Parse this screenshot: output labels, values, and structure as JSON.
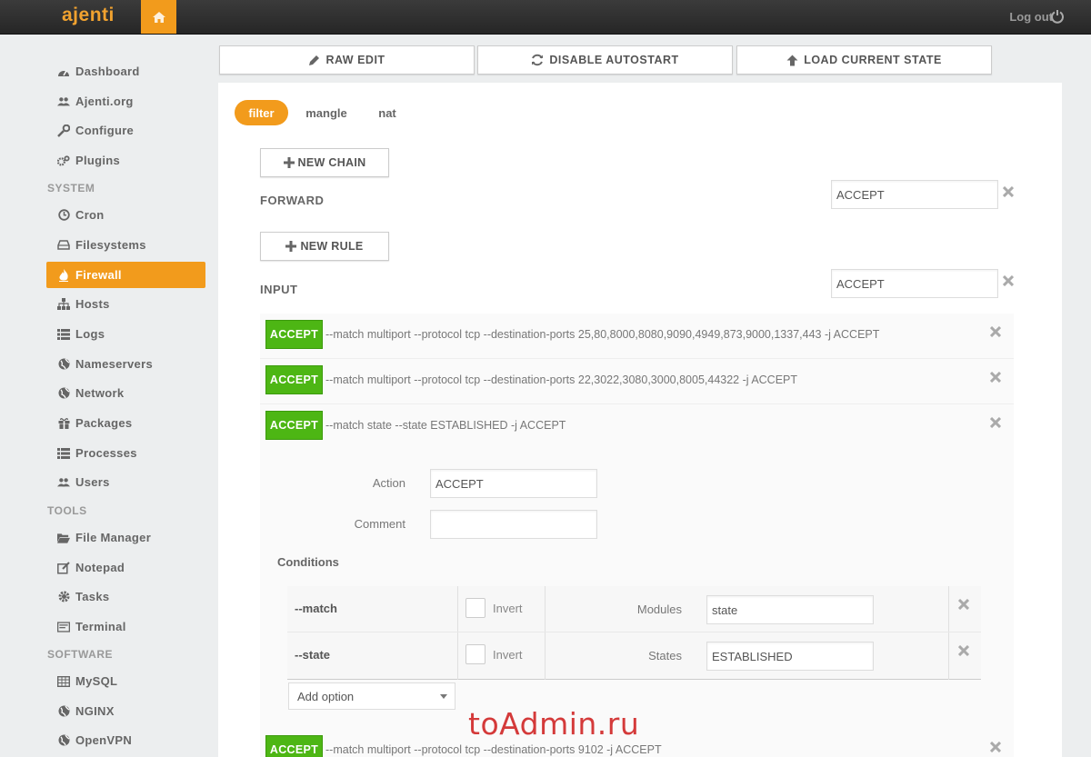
{
  "app": {
    "brand": "ajenti",
    "logout_label": "Log out"
  },
  "sidebar": {
    "items_top": [
      {
        "label": "Dashboard",
        "icon": "dashboard-icon"
      },
      {
        "label": "Ajenti.org",
        "icon": "users-icon"
      },
      {
        "label": "Configure",
        "icon": "wrench-icon"
      },
      {
        "label": "Plugins",
        "icon": "cogs-icon"
      }
    ],
    "sections": [
      {
        "title": "SYSTEM",
        "items": [
          {
            "label": "Cron",
            "icon": "clock-icon"
          },
          {
            "label": "Filesystems",
            "icon": "hdd-icon"
          },
          {
            "label": "Firewall",
            "icon": "fire-icon",
            "active": true
          },
          {
            "label": "Hosts",
            "icon": "sitemap-icon"
          },
          {
            "label": "Logs",
            "icon": "list-icon"
          },
          {
            "label": "Nameservers",
            "icon": "globe-icon"
          },
          {
            "label": "Network",
            "icon": "globe-icon"
          },
          {
            "label": "Packages",
            "icon": "gift-icon"
          },
          {
            "label": "Processes",
            "icon": "tasks-icon"
          },
          {
            "label": "Users",
            "icon": "users-icon"
          }
        ]
      },
      {
        "title": "TOOLS",
        "items": [
          {
            "label": "File Manager",
            "icon": "folder-icon"
          },
          {
            "label": "Notepad",
            "icon": "edit-icon"
          },
          {
            "label": "Tasks",
            "icon": "cog-icon"
          },
          {
            "label": "Terminal",
            "icon": "terminal-icon"
          }
        ]
      },
      {
        "title": "SOFTWARE",
        "items": [
          {
            "label": "MySQL",
            "icon": "table-icon"
          },
          {
            "label": "NGINX",
            "icon": "globe-icon"
          },
          {
            "label": "OpenVPN",
            "icon": "globe-icon"
          }
        ]
      }
    ]
  },
  "toolbar": {
    "raw_edit": "RAW EDIT",
    "disable_autostart": "DISABLE AUTOSTART",
    "load_current_state": "LOAD CURRENT STATE"
  },
  "tabs": [
    "filter",
    "mangle",
    "nat"
  ],
  "active_tab": "filter",
  "buttons": {
    "new_chain": "NEW CHAIN",
    "new_rule": "NEW RULE"
  },
  "chains": [
    {
      "name": "FORWARD",
      "policy": "ACCEPT"
    },
    {
      "name": "INPUT",
      "policy": "ACCEPT"
    }
  ],
  "rules": [
    {
      "action": "ACCEPT",
      "text": "--match multiport --protocol tcp --destination-ports 25,80,8000,8080,9090,4949,873,9000,1337,443 -j ACCEPT"
    },
    {
      "action": "ACCEPT",
      "text": "--match multiport --protocol tcp --destination-ports 22,3022,3080,3000,8005,44322 -j ACCEPT"
    },
    {
      "action": "ACCEPT",
      "text": "--match state --state ESTABLISHED -j ACCEPT"
    },
    {
      "action": "ACCEPT",
      "text": "--match multiport --protocol tcp --destination-ports 9102 -j ACCEPT"
    }
  ],
  "rule_editor": {
    "action_label": "Action",
    "action_value": "ACCEPT",
    "comment_label": "Comment",
    "comment_value": "",
    "conditions_title": "Conditions",
    "conditions": [
      {
        "name": "--match",
        "invert_label": "Invert",
        "field_label": "Modules",
        "value": "state"
      },
      {
        "name": "--state",
        "invert_label": "Invert",
        "field_label": "States",
        "value": "ESTABLISHED"
      }
    ],
    "add_option": "Add option"
  },
  "watermark": "toAdmin.ru",
  "colors": {
    "accent": "#f29b1c",
    "accept": "#4db614",
    "topbar": "#2e2e2e"
  }
}
